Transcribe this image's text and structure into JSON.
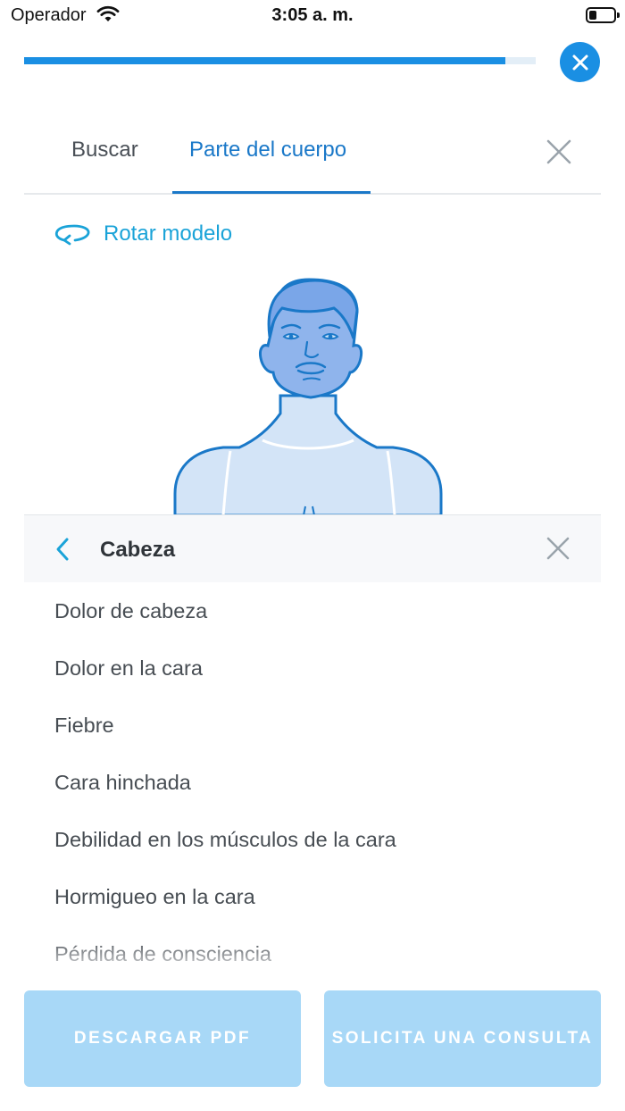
{
  "status_bar": {
    "carrier": "Operador",
    "time": "3:05 a. m."
  },
  "progress": {
    "value": 0.94
  },
  "tabs": [
    {
      "label": "Buscar",
      "selected": false
    },
    {
      "label": "Parte del cuerpo",
      "selected": true
    }
  ],
  "rotate_label": "Rotar modelo",
  "panel": {
    "title": "Cabeza",
    "items": [
      "Dolor de cabeza",
      "Dolor en la cara",
      "Fiebre",
      "Cara hinchada",
      "Debilidad en los músculos de la cara",
      "Hormigueo en la cara",
      "Pérdida de consciencia"
    ]
  },
  "buttons": {
    "download_pdf": "DESCARGAR PDF",
    "request_consult": "SOLICITA UNA CONSULTA"
  },
  "colors": {
    "accent": "#1a8fe3",
    "tab_active": "#1a78c8",
    "button_disabled": "#a8d8f7",
    "highlight": "#8fb4ec"
  },
  "icons": [
    "wifi-icon",
    "battery-icon",
    "close-icon",
    "rotate-icon",
    "chevron-left-icon"
  ]
}
